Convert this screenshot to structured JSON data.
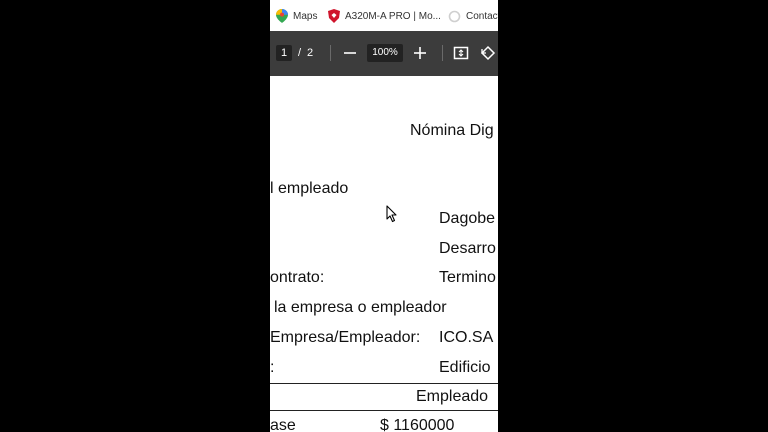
{
  "bookmarks": [
    {
      "label": "Maps",
      "icon": "google-maps-icon"
    },
    {
      "label": "A320M-A PRO | Mo...",
      "icon": "msi-shield-icon"
    },
    {
      "label": "Contact",
      "icon": "loading-circle-icon"
    }
  ],
  "pdf_toolbar": {
    "current_page": "1",
    "separator": "/",
    "total_pages": "2",
    "zoom": "100%",
    "zoom_out_icon": "minus-icon",
    "zoom_in_icon": "plus-icon",
    "fit_icon": "fit-to-page-icon",
    "rotate_icon": "rotate-icon"
  },
  "document": {
    "title": "Nómina Dig",
    "section_employee": "l empleado",
    "value_name": "Dagobe",
    "value_position": "Desarro",
    "label_contract": "ontrato:",
    "value_contract": "Termino",
    "section_employer": "la empresa o empleador",
    "label_company": "Empresa/Empleador:",
    "value_company": "ICO.SA",
    "label_address": ":",
    "value_address": "Edificio",
    "table_header": "Empleado",
    "row_label": "ase",
    "row_value": "$ 1160000"
  },
  "colors": {
    "toolbar_bg": "#3c3c3c",
    "page_bg": "#ffffff",
    "outer_bg": "#000000"
  }
}
